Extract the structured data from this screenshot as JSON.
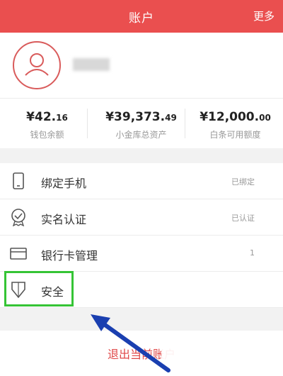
{
  "header": {
    "title": "账户",
    "more": "更多"
  },
  "balances": [
    {
      "amount_main": "¥42.",
      "amount_dec": "16",
      "label": "钱包余额"
    },
    {
      "amount_main": "¥39,373.",
      "amount_dec": "49",
      "label": "小金库总资产"
    },
    {
      "amount_main": "¥12,000.",
      "amount_dec": "00",
      "label": "白条可用额度"
    }
  ],
  "menu": [
    {
      "label": "绑定手机",
      "status": "已绑定",
      "icon": "phone-icon"
    },
    {
      "label": "实名认证",
      "status": "已认证",
      "icon": "verified-badge-icon"
    },
    {
      "label": "银行卡管理",
      "status": "1",
      "icon": "bank-card-icon"
    },
    {
      "label": "安全",
      "status": "",
      "icon": "shield-icon"
    }
  ],
  "logout": {
    "label": "退出当前账户"
  },
  "colors": {
    "header": "#ea4f4f",
    "highlight": "#35c435",
    "arrow": "#1a3fb0",
    "logout_text": "#e04848"
  }
}
